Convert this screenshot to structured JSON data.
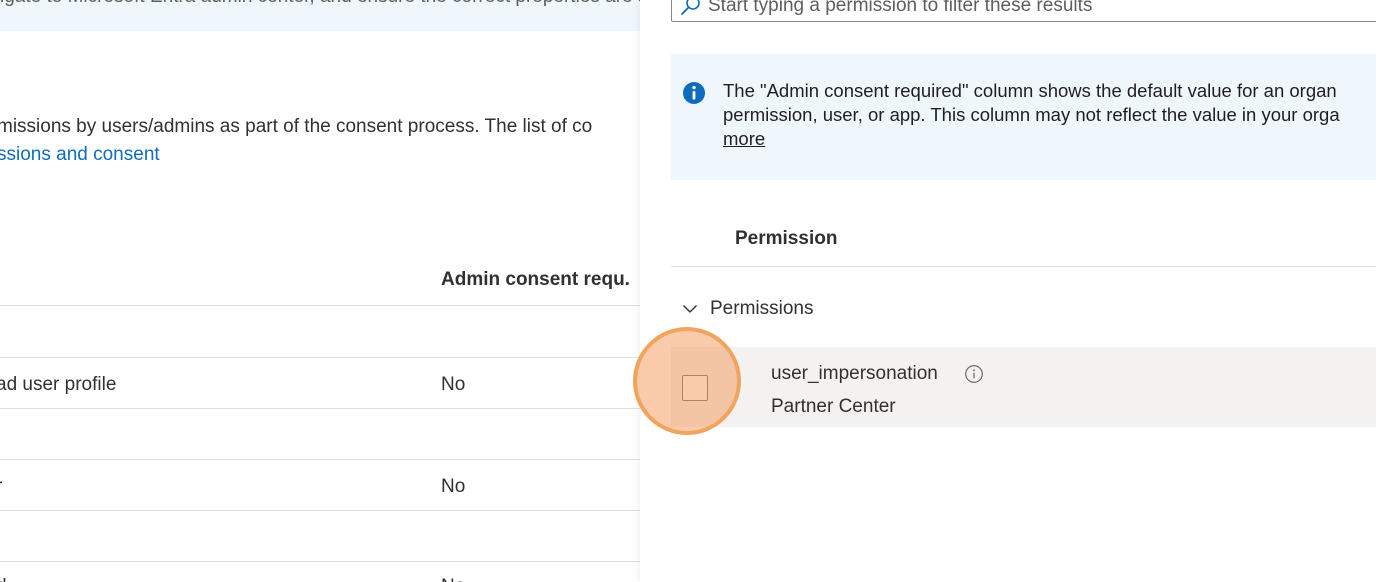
{
  "left_page": {
    "banner_text": "igate to Microsoft Entra admin center, and ensure the correct properties are set",
    "description": "missions by users/admins as part of the consent process. The list of co",
    "link_text": "ssions and consent",
    "column_header": "Admin consent requ.",
    "rows": [
      {
        "permission": "ad user profile",
        "admin_consent": "No"
      },
      {
        "permission": "r",
        "admin_consent": "No"
      },
      {
        "permission": "d",
        "admin_consent": "No"
      }
    ]
  },
  "panel": {
    "search": {
      "placeholder": "Start typing a permission to filter these results",
      "icon": "search-icon"
    },
    "info": {
      "icon": "info-icon",
      "line1": "The \"Admin consent required\" column shows the default value for an organ",
      "line2": "permission, user, or app. This column may not reflect the value in your orga",
      "more_link": "more"
    },
    "table": {
      "column_header": "Permission",
      "group": {
        "label": "Permissions",
        "icon": "chevron-down-icon",
        "expanded": true
      },
      "items": [
        {
          "name": "user_impersonation",
          "api": "Partner Center",
          "checked": false,
          "icon": "info-circle-icon"
        }
      ]
    }
  },
  "colors": {
    "accent": "#0f6cbd",
    "info_background": "#eff6fc",
    "row_hover": "#f3f2f1",
    "highlight": "#f0a45e"
  }
}
